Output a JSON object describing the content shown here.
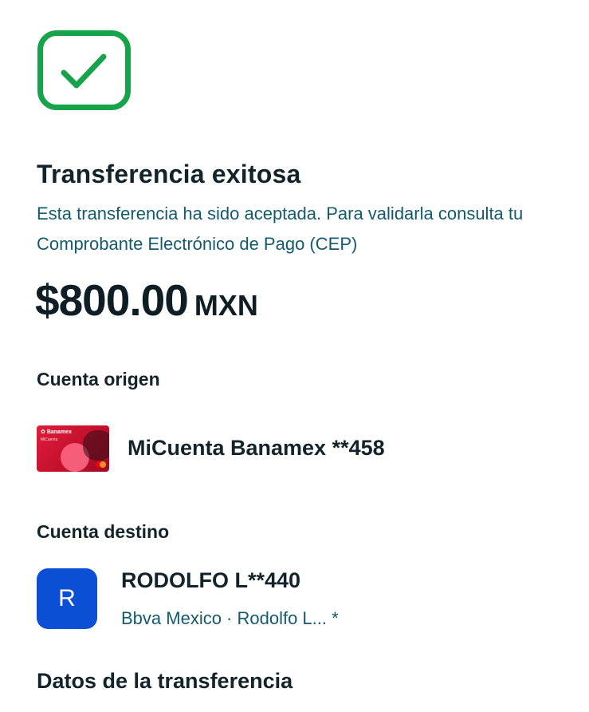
{
  "status": {
    "icon": "check-icon",
    "icon_color": "#17a34a",
    "title": "Transferencia exitosa",
    "message": "Esta transferencia ha sido aceptada. Para validarla consulta tu Comprobante Electrónico de Pago (CEP)"
  },
  "amount": {
    "value": "$800.00",
    "currency": "MXN"
  },
  "origin": {
    "label": "Cuenta origen",
    "card_brand": "Banamex",
    "card_product": "MiCuenta",
    "account_name": "MiCuenta Banamex **458"
  },
  "destination": {
    "label": "Cuenta destino",
    "avatar_initial": "R",
    "avatar_color": "#0a4fd6",
    "name": "RODOLFO L**440",
    "detail": "Bbva Mexico · Rodolfo L... *"
  },
  "transfer_data": {
    "label": "Datos de la transferencia"
  }
}
